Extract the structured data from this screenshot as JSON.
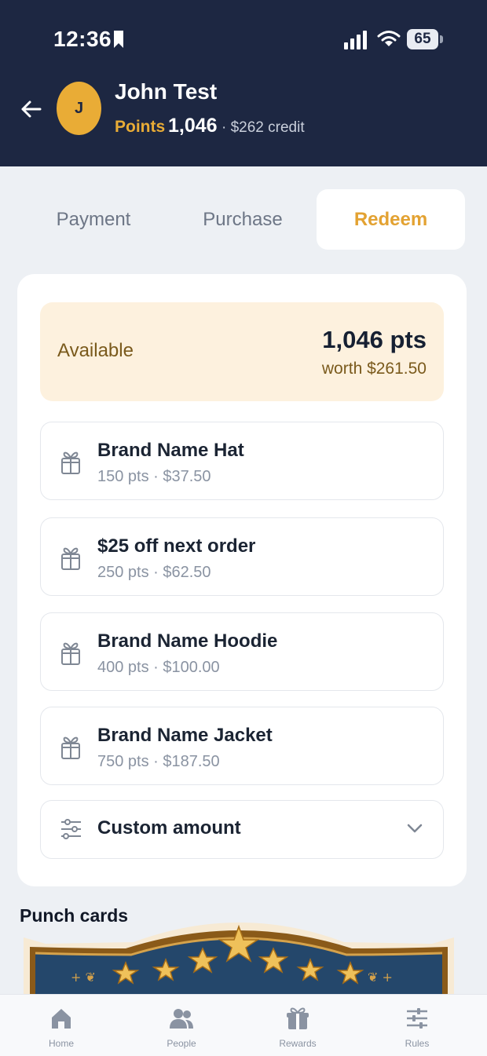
{
  "status_bar": {
    "time": "12:36",
    "battery": "65"
  },
  "header": {
    "user_initial": "J",
    "user_name": "John Test",
    "points_label": "Points",
    "points_value": "1,046",
    "credit": "· $262 credit"
  },
  "tabs": [
    {
      "label": "Payment",
      "active": false
    },
    {
      "label": "Purchase",
      "active": false
    },
    {
      "label": "Redeem",
      "active": true
    }
  ],
  "available": {
    "label": "Available",
    "points": "1,046 pts",
    "worth": "worth $261.50"
  },
  "rewards": [
    {
      "title": "Brand Name Hat",
      "detail": "150 pts · $37.50",
      "icon": "gift-icon"
    },
    {
      "title": "$25 off next order",
      "detail": "250 pts · $62.50",
      "icon": "gift-icon"
    },
    {
      "title": "Brand Name Hoodie",
      "detail": "400 pts · $100.00",
      "icon": "gift-icon"
    },
    {
      "title": "Brand Name Jacket",
      "detail": "750 pts · $187.50",
      "icon": "gift-icon"
    }
  ],
  "custom_amount": {
    "label": "Custom amount",
    "icon": "sliders-icon"
  },
  "punch_cards": {
    "title": "Punch cards"
  },
  "bottom_nav": [
    {
      "label": "Home",
      "icon": "home-icon"
    },
    {
      "label": "People",
      "icon": "people-icon"
    },
    {
      "label": "Rewards",
      "icon": "gift-icon"
    },
    {
      "label": "Rules",
      "icon": "sliders-icon"
    }
  ],
  "colors": {
    "header_background": "#1d2742",
    "accent": "#e9ac36",
    "available_background": "#fdf1de",
    "page_background": "#edf0f4"
  }
}
